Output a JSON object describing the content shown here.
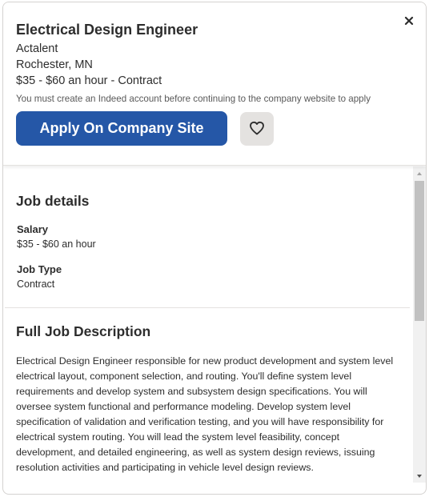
{
  "header": {
    "title": "Electrical Design Engineer",
    "company": "Actalent",
    "location": "Rochester, MN",
    "pay_range": "$35 - $60 an hour",
    "pay_separator": " - ",
    "job_type_inline": "Contract",
    "notice": "You must create an Indeed account before continuing to the company website to apply",
    "apply_label": "Apply On Company Site",
    "close_icon": "close-icon",
    "save_icon": "heart-icon"
  },
  "details": {
    "heading": "Job details",
    "salary_label": "Salary",
    "salary_value": "$35 - $60 an hour",
    "type_label": "Job Type",
    "type_value": "Contract"
  },
  "description": {
    "heading": "Full Job Description",
    "text": "Electrical Design Engineer responsible for new product development and system level electrical layout, component selection, and routing. You'll define system level requirements and develop system and subsystem design specifications. You will oversee system functional and performance modeling. Develop system level specification of validation and verification testing, and you will have responsibility for electrical system routing. You will lead the system level feasibility, concept development, and detailed engineering, as well as system design reviews, issuing resolution activities and participating in vehicle level design reviews."
  },
  "colors": {
    "apply_button": "#2557a7",
    "save_button": "#e4e2e0",
    "text": "#2d2d2d"
  }
}
